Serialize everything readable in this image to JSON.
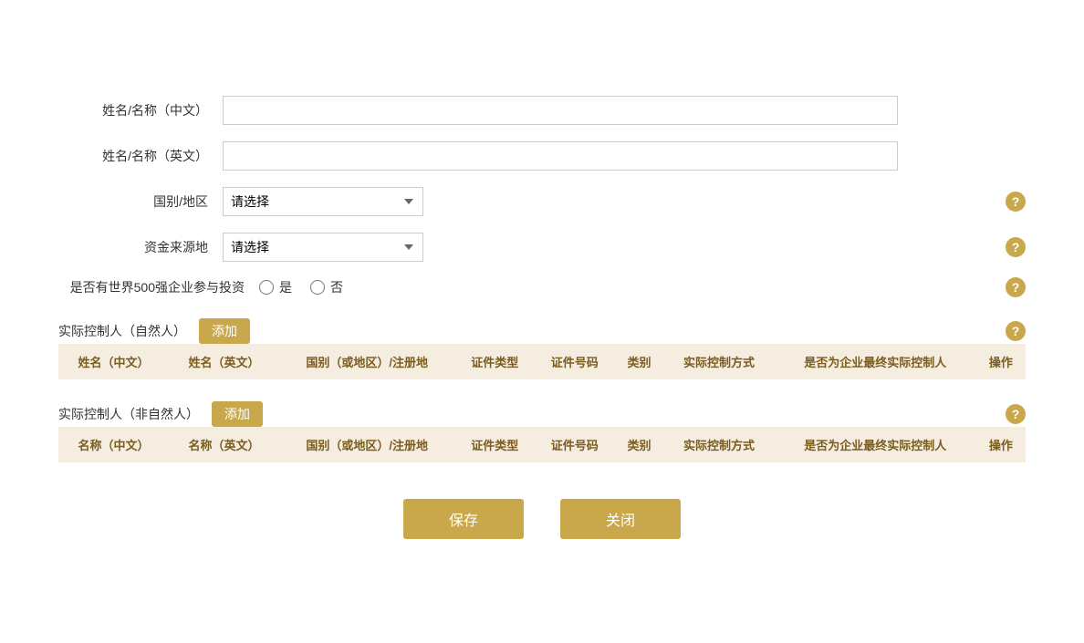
{
  "form": {
    "name_cn_label": "姓名/名称（中文）",
    "name_en_label": "姓名/名称（英文）",
    "country_label": "国别/地区",
    "country_placeholder": "请选择",
    "fund_source_label": "资金来源地",
    "fund_source_placeholder": "请选择",
    "fortune500_label": "是否有世界500强企业参与投资",
    "radio_yes": "是",
    "radio_no": "否"
  },
  "section1": {
    "title": "实际控制人（自然人）",
    "add_label": "添加",
    "help_icon": "?",
    "columns": [
      "姓名（中文）",
      "姓名（英文）",
      "国别（或地区）/注册地",
      "证件类型",
      "证件号码",
      "类别",
      "实际控制方式",
      "是否为企业最终实际控制人",
      "操作"
    ]
  },
  "section2": {
    "title": "实际控制人（非自然人）",
    "add_label": "添加",
    "help_icon": "?",
    "columns": [
      "名称（中文）",
      "名称（英文）",
      "国别（或地区）/注册地",
      "证件类型",
      "证件号码",
      "类别",
      "实际控制方式",
      "是否为企业最终实际控制人",
      "操作"
    ]
  },
  "buttons": {
    "save": "保存",
    "close": "关闭"
  },
  "help_icon_text": "?"
}
